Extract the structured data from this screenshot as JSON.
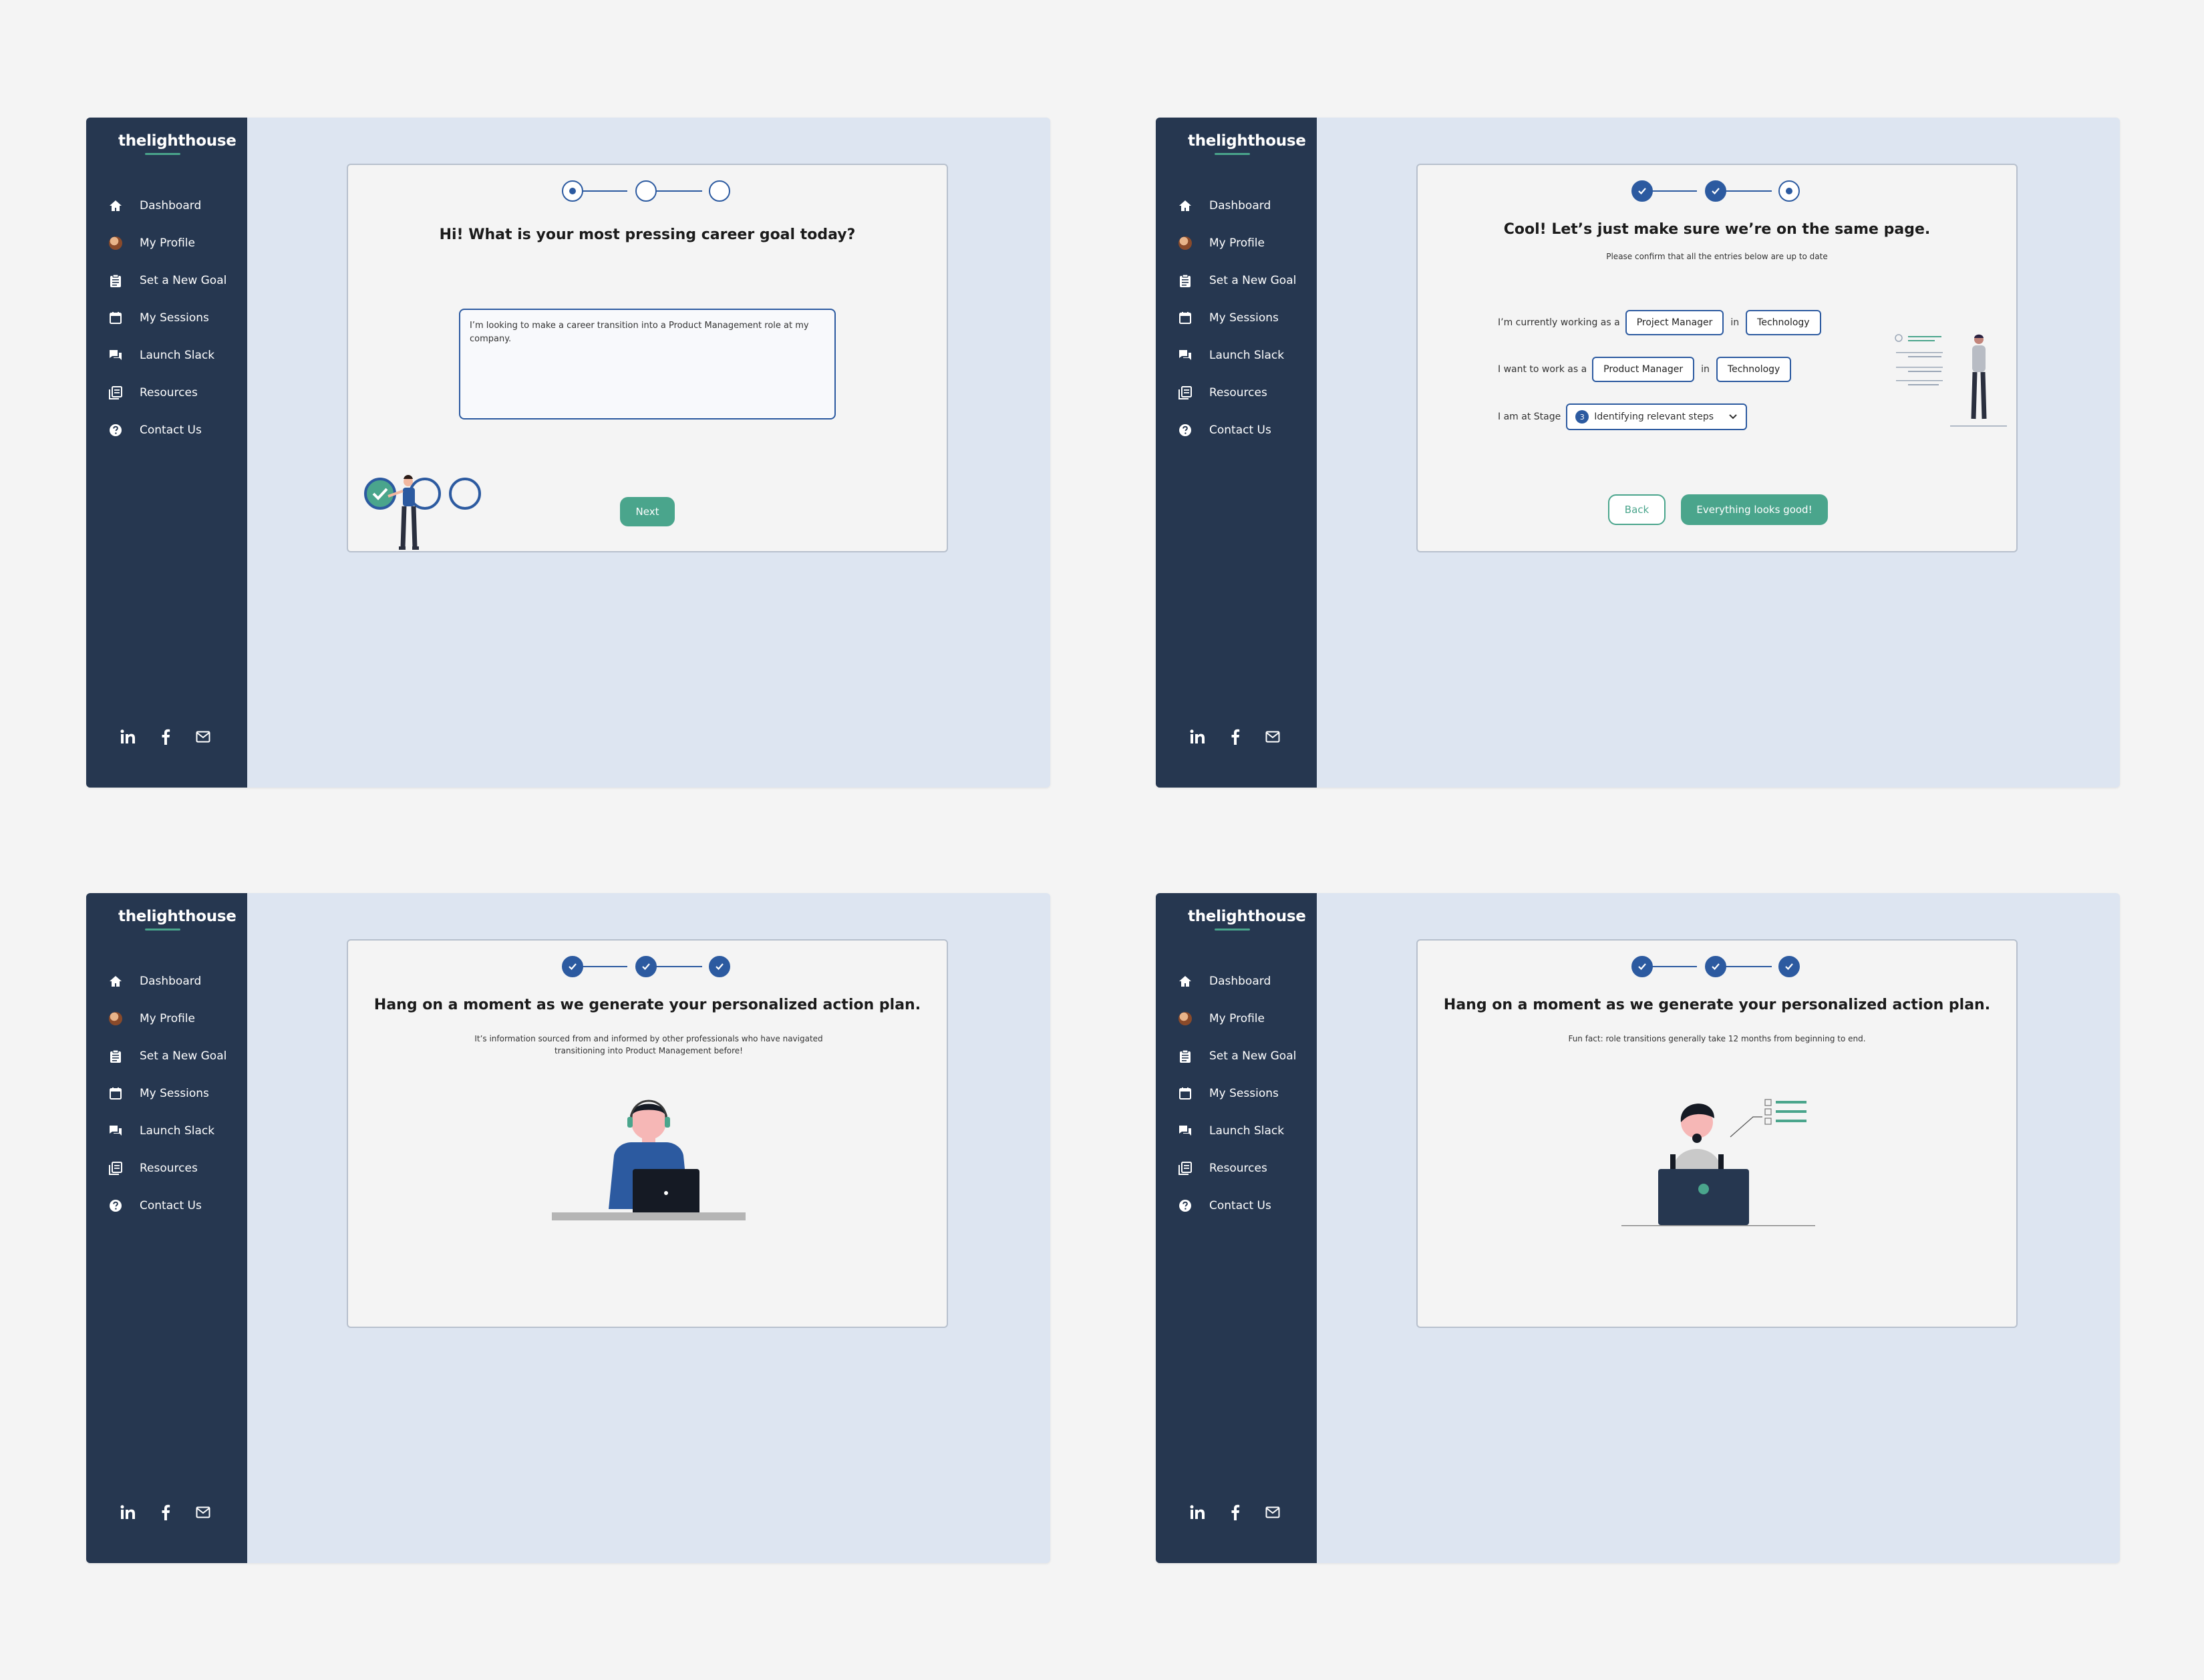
{
  "brand": {
    "name": "thelighthouse",
    "accent": "#4aa58c",
    "sidebar_bg": "#263750",
    "primary": "#2c5aa0"
  },
  "nav": [
    {
      "label": "Dashboard",
      "icon": "home-icon"
    },
    {
      "label": "My Profile",
      "icon": "avatar"
    },
    {
      "label": "Set a New Goal",
      "icon": "clipboard-icon"
    },
    {
      "label": "My Sessions",
      "icon": "calendar-icon"
    },
    {
      "label": "Launch Slack",
      "icon": "chat-icon"
    },
    {
      "label": "Resources",
      "icon": "book-icon"
    },
    {
      "label": "Contact Us",
      "icon": "help-icon"
    }
  ],
  "social": [
    "linkedin-icon",
    "facebook-icon",
    "mail-icon"
  ],
  "screen1": {
    "title": "Hi! What is your most pressing career goal today?",
    "goal_text": "I’m looking to make a career transition into a Product Management role at my company.",
    "next_label": "Next"
  },
  "screen2": {
    "title": "Cool! Let’s just make sure we’re on the same page.",
    "subtitle": "Please confirm that all the entries below are up to date",
    "row1_label": "I’m currently working as a",
    "row1_role": "Project Manager",
    "row_in": "in",
    "row1_industry": "Technology",
    "row2_label": "I want to work as a",
    "row2_role": "Product Manager",
    "row2_industry": "Technology",
    "row3_label": "I am at Stage",
    "stage_number": "3",
    "stage_value": "Identifying relevant steps",
    "back_label": "Back",
    "confirm_label": "Everything looks good!"
  },
  "screen3": {
    "title": "Hang on a moment as we generate your personalized action plan.",
    "subtitle": "It’s information sourced from and informed by other professionals who have navigated transitioning into Product Management before!"
  },
  "screen4": {
    "title": "Hang on a moment as we generate your personalized action plan.",
    "subtitle": "Fun fact: role transitions generally take 12 months from beginning to end."
  }
}
